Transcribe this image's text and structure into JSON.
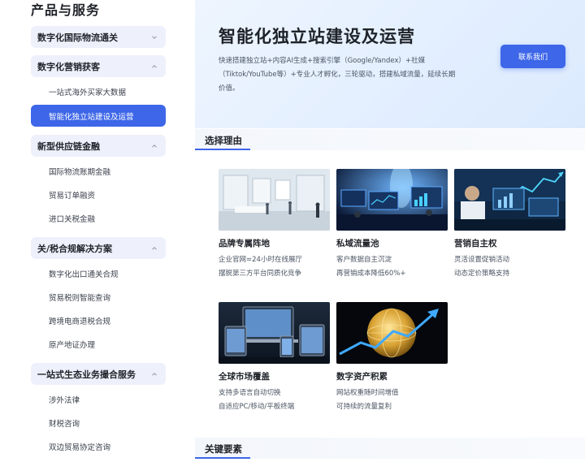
{
  "sidebar": {
    "title": "产品与服务",
    "groups": [
      {
        "label": "数字化国际物流通关",
        "chevron": "down",
        "items": []
      },
      {
        "label": "数字化营销获客",
        "chevron": "up",
        "items": [
          "一站式海外买家大数据",
          "智能化独立站建设及运营"
        ]
      },
      {
        "label": "新型供应链金融",
        "chevron": "up",
        "items": [
          "国际物流账期金融",
          "贸易订单融资",
          "进口关税金融"
        ]
      },
      {
        "label": "关/税合规解决方案",
        "chevron": "up",
        "items": [
          "数字化出口通关合规",
          "贸易税则智能查询",
          "跨境电商退税合规",
          "原产地证办理"
        ]
      },
      {
        "label": "一站式生态业务撮合服务",
        "chevron": "up",
        "items": [
          "涉外法律",
          "财税咨询",
          "双边贸易协定咨询"
        ]
      }
    ],
    "active_item": "智能化独立站建设及运营"
  },
  "hero": {
    "title": "智能化独立站建设及运营",
    "description_line1": "快速搭建独立站+内容AI生成+搜索引擎（Google/Yandex）+社媒",
    "description_line2": "（Tiktok/YouTube等）+专业人才孵化，三轮驱动，搭建私域流量，延续长期",
    "description_line3": "价值。",
    "button": "联系我们"
  },
  "sections": {
    "reasons": "选择理由",
    "key_elements": "关键要素"
  },
  "cards": [
    {
      "title": "品牌专属阵地",
      "line1": "企业官网=24小时在线展厅",
      "line2": "摆脱第三方平台同质化竞争",
      "image": "showroom-image"
    },
    {
      "title": "私域流量池",
      "line1": "客户数据自主沉淀",
      "line2": "再营销成本降低60%+",
      "image": "data-screens-image"
    },
    {
      "title": "营销自主权",
      "line1": "灵活设置促销活动",
      "line2": "动态定价策略支持",
      "image": "analytics-image"
    },
    {
      "title": "全球市场覆盖",
      "line1": "支持多语言自动切换",
      "line2": "自适应PC/移动/平板终端",
      "image": "devices-image"
    },
    {
      "title": "数字资产积累",
      "line1": "网站权重随时间增值",
      "line2": "可持续的流量复利",
      "image": "globe-growth-image"
    }
  ],
  "colors": {
    "accent": "#3d66e8",
    "group_bg": "#eef1fb",
    "hero_bg": "#e3efff"
  }
}
